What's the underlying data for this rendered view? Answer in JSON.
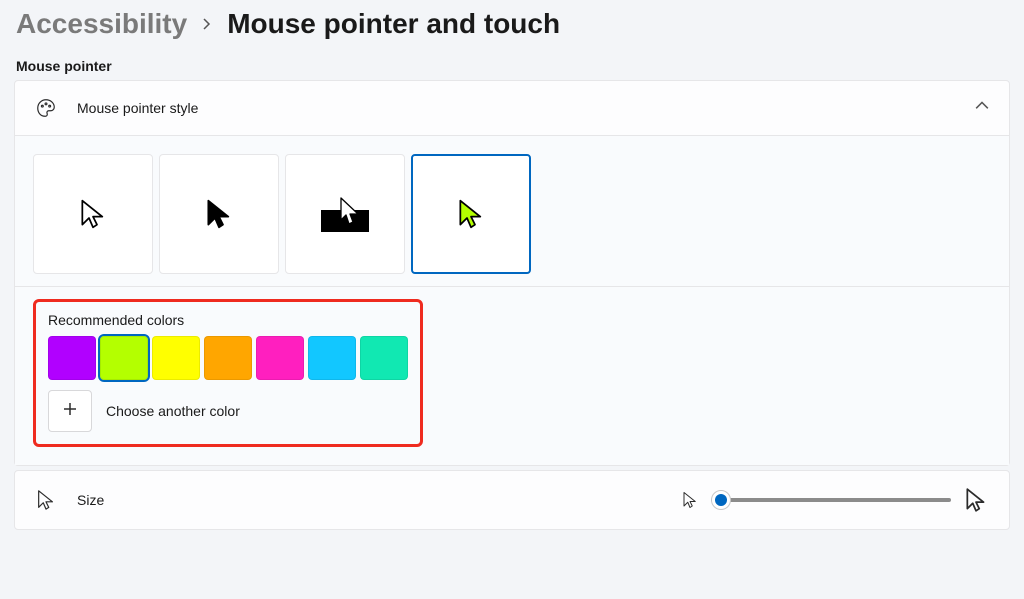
{
  "breadcrumb": {
    "parent": "Accessibility",
    "page": "Mouse pointer and touch"
  },
  "section_label": "Mouse pointer",
  "style_card": {
    "title": "Mouse pointer style"
  },
  "colors": {
    "title": "Recommended colors",
    "swatches": [
      "#b100ff",
      "#b4ff00",
      "#ffff00",
      "#ffa600",
      "#ff1fbf",
      "#12c7ff",
      "#11e8b2"
    ],
    "selected_index": 1,
    "choose_label": "Choose another color"
  },
  "size_card": {
    "label": "Size"
  },
  "pointer_styles": {
    "selected_index": 3
  }
}
